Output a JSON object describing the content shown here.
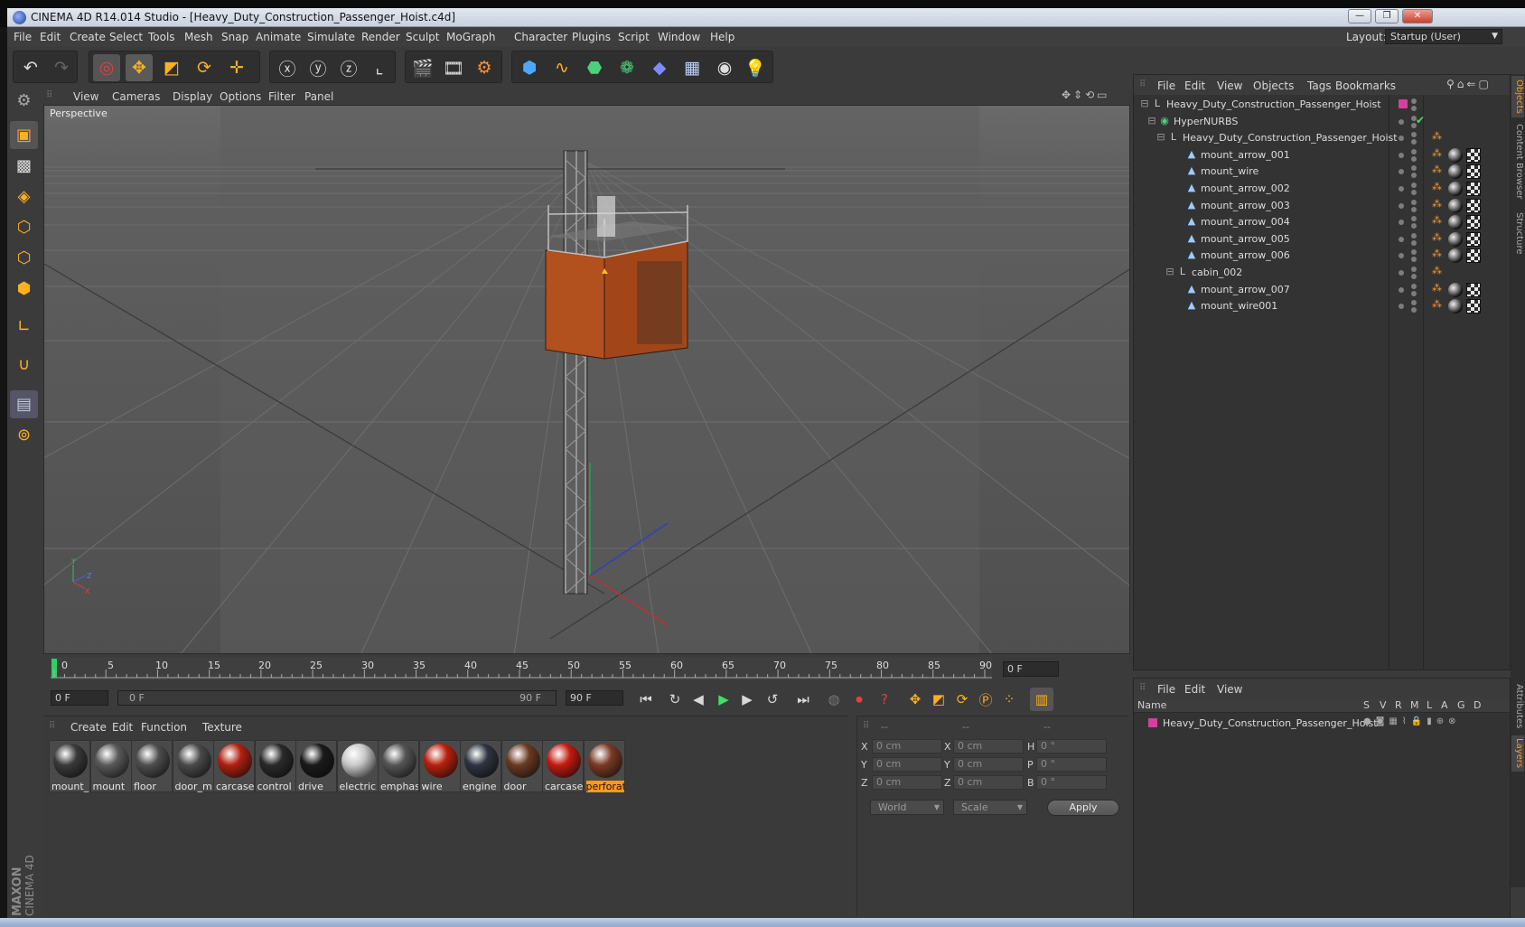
{
  "window": {
    "title": "CINEMA 4D R14.014 Studio - [Heavy_Duty_Construction_Passenger_Hoist.c4d]",
    "minimize": "—",
    "restore": "❐",
    "close": "✕"
  },
  "menubar": {
    "items": [
      "File",
      "Edit",
      "Create",
      "Select",
      "Tools",
      "Mesh",
      "Snap",
      "Animate",
      "Simulate",
      "Render",
      "Sculpt",
      "MoGraph",
      "Character",
      "Plugins",
      "Script",
      "Window",
      "Help"
    ],
    "layout_label": "Layout:",
    "layout_value": "Startup (User)"
  },
  "viewport": {
    "menu": [
      "View",
      "Cameras",
      "Display",
      "Options",
      "Filter",
      "Panel"
    ],
    "label": "Perspective"
  },
  "timeline": {
    "ticks": [
      "0",
      "5",
      "10",
      "15",
      "20",
      "25",
      "30",
      "35",
      "40",
      "45",
      "50",
      "55",
      "60",
      "65",
      "70",
      "75",
      "80",
      "85",
      "90"
    ],
    "end_field": "0 F",
    "current_frame": "0 F",
    "range_start": "0 F",
    "range_end": "90 F",
    "max_frame": "90 F"
  },
  "materials": {
    "menu": [
      "Create",
      "Edit",
      "Function",
      "Texture"
    ],
    "items": [
      {
        "label": "mount_",
        "color": "#3a3a3a"
      },
      {
        "label": "mount",
        "color": "#5a5a5a"
      },
      {
        "label": "floor",
        "color": "#4e4e4e"
      },
      {
        "label": "door_m",
        "color": "#4a4a4a"
      },
      {
        "label": "carcase_",
        "color": "#b02010"
      },
      {
        "label": "control",
        "color": "#2a2a2a"
      },
      {
        "label": "drive",
        "color": "#1a1a1a"
      },
      {
        "label": "electric",
        "color": "#c9c9c9"
      },
      {
        "label": "emphas",
        "color": "#555555"
      },
      {
        "label": "wire",
        "color": "#b8200e"
      },
      {
        "label": "engine",
        "color": "#2e3440"
      },
      {
        "label": "door",
        "color": "#6a3a22"
      },
      {
        "label": "carcase",
        "color": "#c41a10"
      },
      {
        "label": "perforat",
        "color": "#7a3a24"
      }
    ]
  },
  "coords": {
    "header": [
      "--",
      "--",
      "--"
    ],
    "rows": [
      {
        "a": "X",
        "av": "0 cm",
        "b": "X",
        "bv": "0 cm",
        "c": "H",
        "cv": "0 °"
      },
      {
        "a": "Y",
        "av": "0 cm",
        "b": "Y",
        "bv": "0 cm",
        "c": "P",
        "cv": "0 °"
      },
      {
        "a": "Z",
        "av": "0 cm",
        "b": "Z",
        "bv": "0 cm",
        "c": "B",
        "cv": "0 °"
      }
    ],
    "space": "World",
    "mode": "Scale",
    "apply": "Apply"
  },
  "objects": {
    "menu": [
      "File",
      "Edit",
      "View",
      "Objects",
      "Tags",
      "Bookmarks"
    ],
    "tree": [
      {
        "name": "Heavy_Duty_Construction_Passenger_Hoist",
        "type": "null"
      },
      {
        "name": "HyperNURBS",
        "type": "hypernurbs"
      },
      {
        "name": "Heavy_Duty_Construction_Passenger_Hoist",
        "type": "null"
      },
      {
        "name": "mount_arrow_001",
        "type": "poly"
      },
      {
        "name": "mount_wire",
        "type": "poly"
      },
      {
        "name": "mount_arrow_002",
        "type": "poly"
      },
      {
        "name": "mount_arrow_003",
        "type": "poly"
      },
      {
        "name": "mount_arrow_004",
        "type": "poly"
      },
      {
        "name": "mount_arrow_005",
        "type": "poly"
      },
      {
        "name": "mount_arrow_006",
        "type": "poly"
      },
      {
        "name": "cabin_002",
        "type": "null"
      },
      {
        "name": "mount_arrow_007",
        "type": "poly"
      },
      {
        "name": "mount_wire001",
        "type": "poly"
      }
    ]
  },
  "layers": {
    "menu": [
      "File",
      "Edit",
      "View"
    ],
    "columns": [
      "Name",
      "S",
      "V",
      "R",
      "M",
      "L",
      "A",
      "G",
      "D"
    ],
    "items": [
      {
        "name": "Heavy_Duty_Construction_Passenger_Hoist",
        "color": "#d63fa0"
      }
    ]
  },
  "right_tabs": [
    "Objects",
    "Content Browser",
    "Structure",
    "Attributes",
    "Layers"
  ],
  "logo": {
    "brand": "MAXON",
    "product": "CINEMA 4D"
  },
  "colors": {
    "accent": "#f29a2e",
    "selection": "#ff9a1a",
    "layer": "#d63fa0"
  }
}
